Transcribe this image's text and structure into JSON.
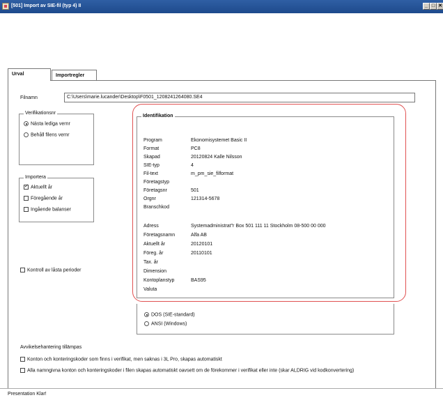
{
  "window": {
    "title": "[501]  Import av SIE-fil (typ 4) II",
    "buttons": [
      "_",
      "□",
      "✕"
    ]
  },
  "tabs": [
    {
      "label": "Urval",
      "active": true
    },
    {
      "label": "Importregler",
      "active": false
    }
  ],
  "filnamn": {
    "label": "Filnamn",
    "value": "C:\\Users\\marie.lucander\\Desktop\\F0501_1208241264080.SE4"
  },
  "verifikationsnr": {
    "title": "Verifikationsnr",
    "options": [
      {
        "label": "Nästa lediga vernr",
        "selected": true
      },
      {
        "label": "Behåll filens vernr",
        "selected": false
      }
    ]
  },
  "importera": {
    "title": "Importera",
    "options": [
      {
        "label": "Aktuellt år",
        "checked": true
      },
      {
        "label": "Föregående år",
        "checked": false
      },
      {
        "label": "Ingående balanser",
        "checked": false
      }
    ]
  },
  "kontroll": {
    "label": "Kontroll av låsta perioder",
    "checked": false
  },
  "identifikation": {
    "title": "Identifikation",
    "rows": [
      {
        "key": "Program",
        "value": "Ekonomisystemet Basic II"
      },
      {
        "key": "Format",
        "value": "PC8"
      },
      {
        "key": "Skapad",
        "value": "20120824  Kalle Nilsson"
      },
      {
        "key": "SIE-typ",
        "value": "4"
      },
      {
        "key": "Fil-text",
        "value": "m_pm_sie_filformat"
      },
      {
        "key": "Företagstyp",
        "value": ""
      },
      {
        "key": "Företagsnr",
        "value": "501"
      },
      {
        "key": "Orgnr",
        "value": "121314-5678"
      },
      {
        "key": "Branschkod",
        "value": ""
      },
      {
        "key": "Adress",
        "value": "Systemadministrat\"r Box 501 111 11 Stockholm 08-500 00 000"
      },
      {
        "key": "Företagsnamn",
        "value": "Alfa AB"
      },
      {
        "key": "Aktuellt år",
        "value": "20120101"
      },
      {
        "key": "Föreg. år",
        "value": "20110101"
      },
      {
        "key": "Tax. år",
        "value": ""
      },
      {
        "key": "Dimension",
        "value": ""
      },
      {
        "key": "Kontoplanstyp",
        "value": "BAS95"
      },
      {
        "key": "Valuta",
        "value": ""
      }
    ]
  },
  "teckenkod": {
    "options": [
      {
        "label": "DOS (SIE-standard)",
        "selected": true
      },
      {
        "label": "ANSI (Windows)",
        "selected": false
      }
    ]
  },
  "avvikelse": {
    "title": "Avvikelsehantering tillämpas",
    "options": [
      {
        "label": "Konton och konteringskoder som finns i verifikat, men saknas i 3L Pro, skapas automatiskt",
        "checked": false
      },
      {
        "label": "Alla namngivna konton och konteringskoder i filen skapas automatiskt oavsett om de förekommer i verifikat eller inte (skar ALDRIG vid kodkonvertering)",
        "checked": false
      }
    ]
  },
  "status": {
    "text": "Presentation Klar!"
  },
  "colors": {
    "titlebar": "#1e4a8c",
    "highlight": "#e05050"
  }
}
